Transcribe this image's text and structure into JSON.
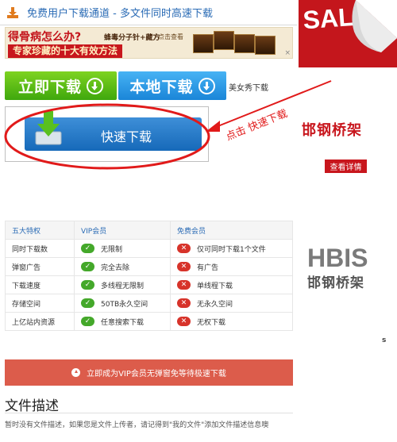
{
  "header": {
    "title": "免费用户下载通道 - 多文件同时高速下载",
    "icon": "download-icon"
  },
  "ad_banner": {
    "headline": "得骨病怎么办?",
    "product": "蜂毒分子针+藏方",
    "cta": "点击查看",
    "subline": "专家珍藏的十大有效方法",
    "close": "×"
  },
  "sale_corner": {
    "text": "SALE"
  },
  "buttons": {
    "download_now": "立即下载",
    "local_download": "本地下载",
    "file_name": "美女秀下载",
    "quick_download": "快速下载"
  },
  "annotation": {
    "click_fast": "点击 快速下载"
  },
  "side_ad": {
    "brand_small": "邯钢桥架",
    "details_button": "查看详情",
    "logo_latin": "HBIS",
    "logo_cn": "邯钢桥架",
    "stray_char": "s"
  },
  "feature_table": {
    "headers": [
      "五大特权",
      "VIP会员",
      "免费会员"
    ],
    "rows": [
      {
        "feature": "同时下载数",
        "vip": "无限制",
        "free": "仅可同时下载1个文件"
      },
      {
        "feature": "弹窗广告",
        "vip": "完全去除",
        "free": "有广告"
      },
      {
        "feature": "下载速度",
        "vip": "多线程无限制",
        "free": "单线程下载"
      },
      {
        "feature": "存储空间",
        "vip": "50TB永久空间",
        "free": "无永久空间"
      },
      {
        "feature": "上亿站内资源",
        "vip": "任意搜索下载",
        "free": "无权下载"
      }
    ]
  },
  "vip_bar": {
    "label": "立即成为VIP会员无弹窗免等待极速下载"
  },
  "description": {
    "title": "文件描述",
    "text": "暂时没有文件描述，如果您是文件上传者，请记得到\"我的文件\"添加文件描述信息噢"
  },
  "colors": {
    "accent_blue": "#2a6bb5",
    "green": "#44a82a",
    "red": "#d7332a",
    "vip_bar": "#dc5c4b",
    "annotation_red": "#e11a1a"
  }
}
